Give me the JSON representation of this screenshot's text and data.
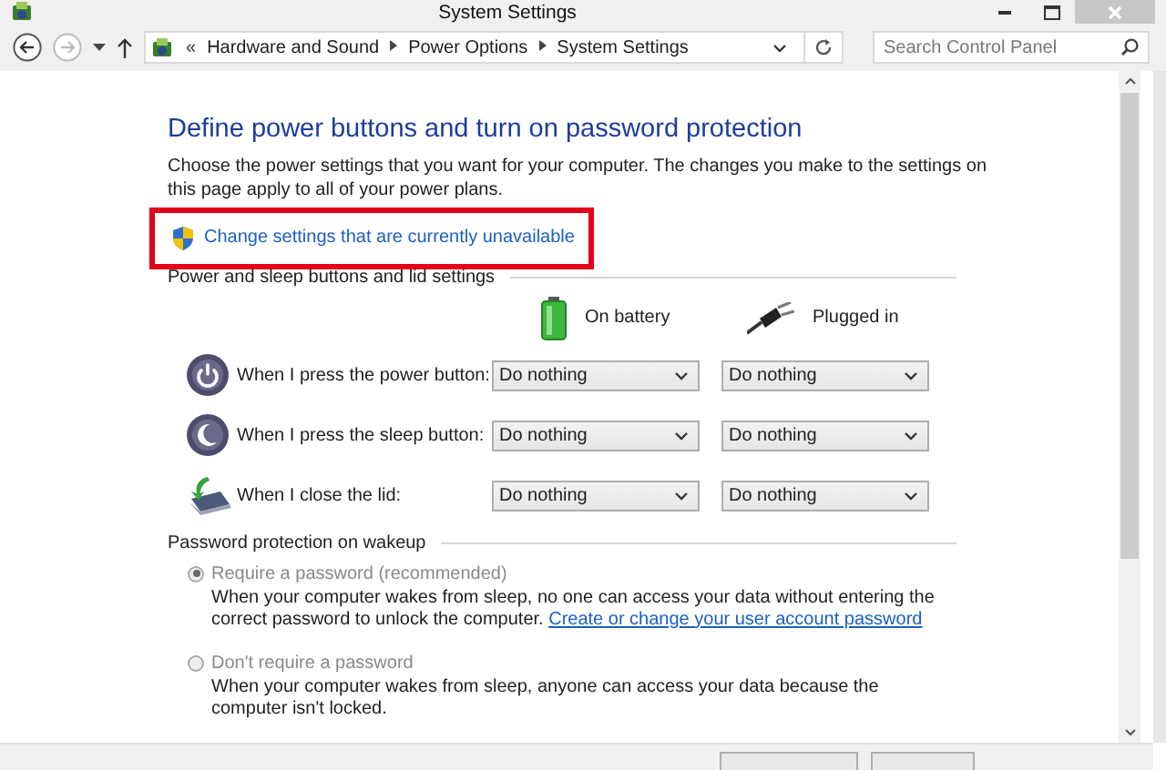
{
  "window": {
    "title": "System Settings"
  },
  "navigation": {
    "overflow": "«",
    "breadcrumbs": [
      "Hardware and Sound",
      "Power Options",
      "System Settings"
    ],
    "search": {
      "placeholder": "Search Control Panel"
    }
  },
  "page": {
    "heading": "Define power buttons and turn on password protection",
    "description": "Choose the power settings that you want for your computer. The changes you make to the settings on this page apply to all of your power plans.",
    "link": {
      "text": "Change settings that are currently unavailable",
      "highlighted": true
    }
  },
  "power_settings": {
    "title": "Power and sleep buttons and lid settings",
    "columns": [
      {
        "label": "On battery",
        "kind": "battery"
      },
      {
        "label": "Plugged in",
        "kind": "plug"
      }
    ],
    "rows": [
      {
        "kind": "power",
        "label": "When I press the power button:",
        "values": [
          "Do nothing",
          "Do nothing"
        ]
      },
      {
        "kind": "sleep",
        "label": "When I press the sleep button:",
        "values": [
          "Do nothing",
          "Do nothing"
        ]
      },
      {
        "kind": "lid",
        "label": "When I close the lid:",
        "values": [
          "Do nothing",
          "Do nothing"
        ]
      }
    ]
  },
  "password_protection": {
    "title": "Password protection on wakeup",
    "options": [
      {
        "label": "Require a password (recommended)",
        "selected": true,
        "disabled": true,
        "description": "When your computer wakes from sleep, no one can access your data without entering the correct password to unlock the computer.",
        "link": "Create or change your user account password"
      },
      {
        "label": "Don't require a password",
        "selected": false,
        "disabled": true,
        "description": "When your computer wakes from sleep, anyone can access your data because the computer isn't locked."
      }
    ]
  }
}
